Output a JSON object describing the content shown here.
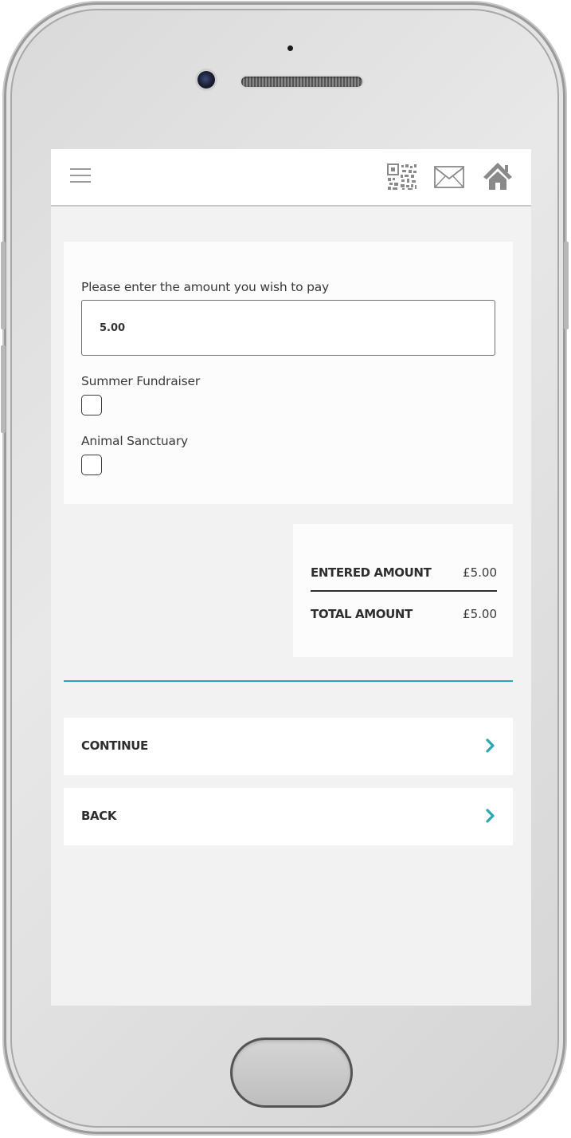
{
  "header": {
    "menu_icon": "hamburger-menu-icon",
    "qr_icon": "qr-code-icon",
    "mail_icon": "envelope-icon",
    "home_icon": "home-icon"
  },
  "form": {
    "amount_label": "Please enter the amount you wish to pay",
    "amount_value": "5.00",
    "options": [
      {
        "label": "Summer Fundraiser",
        "checked": false
      },
      {
        "label": "Animal Sanctuary",
        "checked": false
      }
    ]
  },
  "totals": {
    "entered_label": "ENTERED AMOUNT",
    "entered_value": "£5.00",
    "total_label": "TOTAL AMOUNT",
    "total_value": "£5.00"
  },
  "actions": {
    "continue_label": "CONTINUE",
    "back_label": "BACK"
  },
  "colors": {
    "accent": "#2aa6b1",
    "screen_bg": "#f2f2f2"
  }
}
